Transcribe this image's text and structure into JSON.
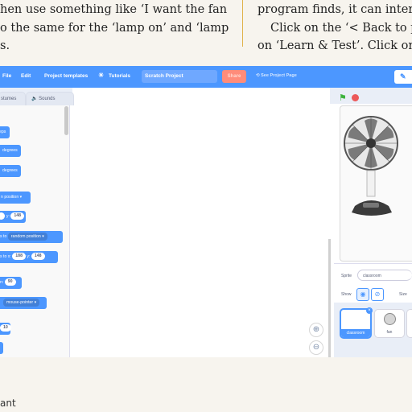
{
  "book": {
    "left_lines": [
      "hen use something like ‘I want the fan",
      "o the same for the ‘lamp on’ and ‘lamp",
      "s."
    ],
    "right_lines": [
      "program finds, it can interp",
      "Click on the ‘< Back to pro",
      "on ‘Learn & Test’. Click on t"
    ],
    "footer": "ant"
  },
  "menubar": {
    "file": "File",
    "edit": "Edit",
    "project_templates": "Project templates",
    "tutorials": "Tutorials",
    "project_title": "Scratch Project",
    "share": "Share",
    "see_project_page": "See Project Page"
  },
  "tabs": {
    "costumes": "stumes",
    "sounds": "Sounds"
  },
  "palette_blocks": [
    {
      "prefix": "",
      "suffix": "eps"
    },
    {
      "prefix": "",
      "suffix": "degrees"
    },
    {
      "prefix": "",
      "suffix": "degrees"
    },
    {
      "prefix": "n position",
      "dropdown": true
    },
    {
      "value": "148",
      "label": "y:"
    },
    {
      "prefix": "s to",
      "dd": "random position"
    },
    {
      "prefix": "s to x:",
      "x": "188",
      "y_label": "y:",
      "y": "148"
    },
    {
      "value": "90",
      "prefix": "n:"
    },
    {
      "dd": "mouse-pointer"
    },
    {
      "value": "10"
    }
  ],
  "sprite": {
    "label": "Sprite",
    "name": "classroom",
    "show_label": "Show",
    "size_label": "Size"
  },
  "sprite_list": [
    "classroom",
    "fan"
  ],
  "colors": {
    "scratch_blue": "#4c97ff",
    "flag_green": "#3db33d",
    "stop_red": "#ec5959"
  },
  "icons": [
    "tutorials-bulb-icon",
    "green-flag-icon",
    "stop-icon",
    "zoom-in-icon",
    "zoom-out-icon",
    "edit-icon",
    "show-eye-icon",
    "hide-eye-icon",
    "fan-sprite-icon",
    "sounds-icon",
    "delete-sprite-icon"
  ]
}
